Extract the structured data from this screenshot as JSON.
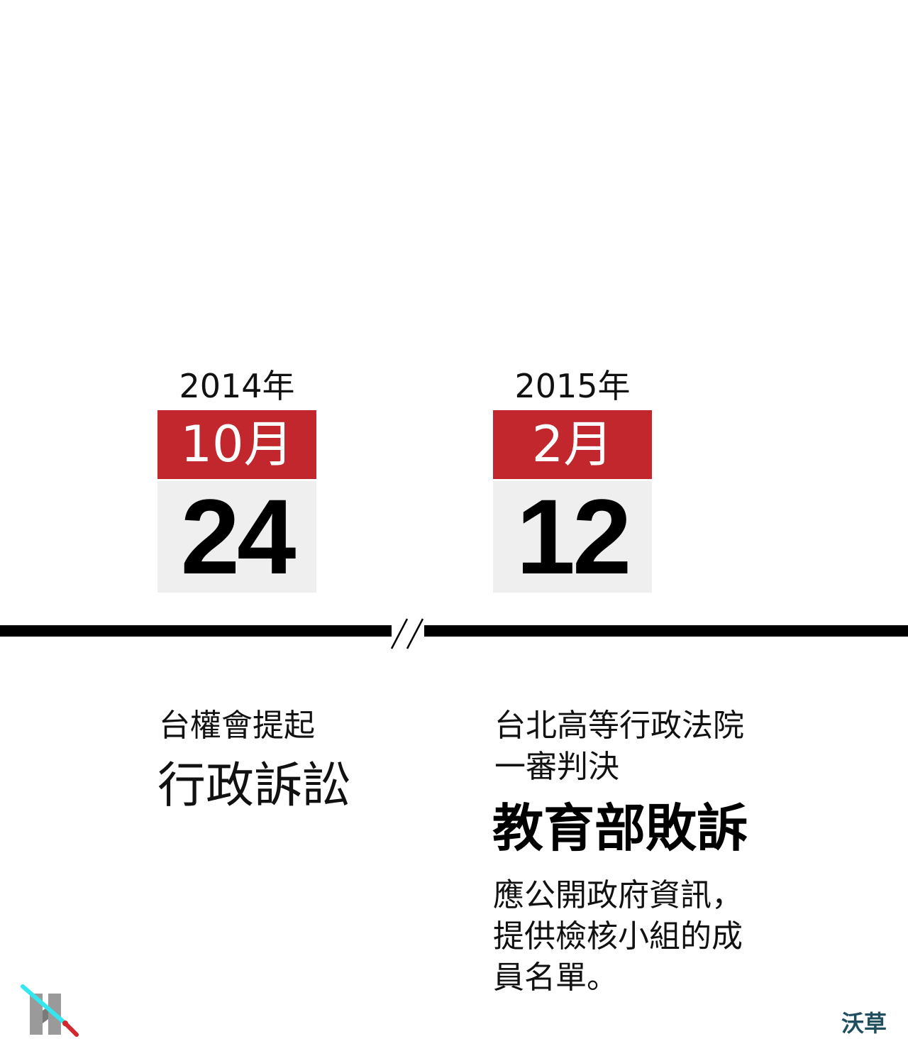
{
  "events": [
    {
      "year": "2014年",
      "month": "10月",
      "day": "24",
      "lines": [
        "台權會提起",
        "行政訴訟"
      ]
    },
    {
      "year": "2015年",
      "month": "2月",
      "day": "12",
      "lines": [
        "台北高等行政法院",
        "一審判決"
      ],
      "highlight": "教育部敗訴",
      "detail_lines": [
        "應公開政府資訊，",
        "提供檢核小組的成",
        "員名單。"
      ]
    }
  ],
  "brand": "沃草",
  "colors": {
    "accent": "#c1272d",
    "day_bg": "#efefef",
    "brand": "#1f4f5f"
  }
}
